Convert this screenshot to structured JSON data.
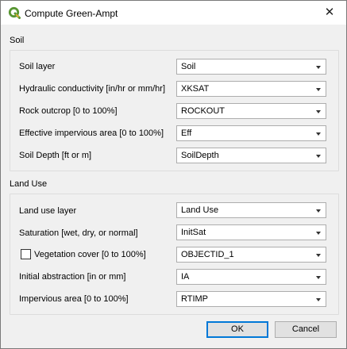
{
  "window": {
    "title": "Compute Green-Ampt",
    "close_glyph": "✕",
    "icon": "qgis-logo-icon"
  },
  "soil": {
    "title": "Soil",
    "rows": [
      {
        "label": "Soil layer",
        "value": "Soil"
      },
      {
        "label": "Hydraulic conductivity [in/hr or mm/hr]",
        "value": "XKSAT"
      },
      {
        "label": "Rock outcrop [0 to 100%]",
        "value": "ROCKOUT"
      },
      {
        "label": "Effective impervious area [0 to 100%]",
        "value": "Eff"
      },
      {
        "label": "Soil Depth [ft or m]",
        "value": "SoilDepth"
      }
    ]
  },
  "land_use": {
    "title": "Land Use",
    "rows": [
      {
        "label": "Land use layer",
        "value": "Land Use"
      },
      {
        "label": "Saturation [wet, dry, or normal]",
        "value": "InitSat"
      },
      {
        "label": "Vegetation cover [0 to 100%]",
        "value": "OBJECTID_1",
        "checked": false
      },
      {
        "label": "Initial abstraction [in or mm]",
        "value": "IA"
      },
      {
        "label": "Impervious area [0 to 100%]",
        "value": "RTIMP"
      }
    ]
  },
  "buttons": {
    "ok": "OK",
    "cancel": "Cancel"
  },
  "colors": {
    "accent": "#0078d7",
    "qgis_green": "#589632",
    "qgis_yellow": "#ee7913"
  }
}
